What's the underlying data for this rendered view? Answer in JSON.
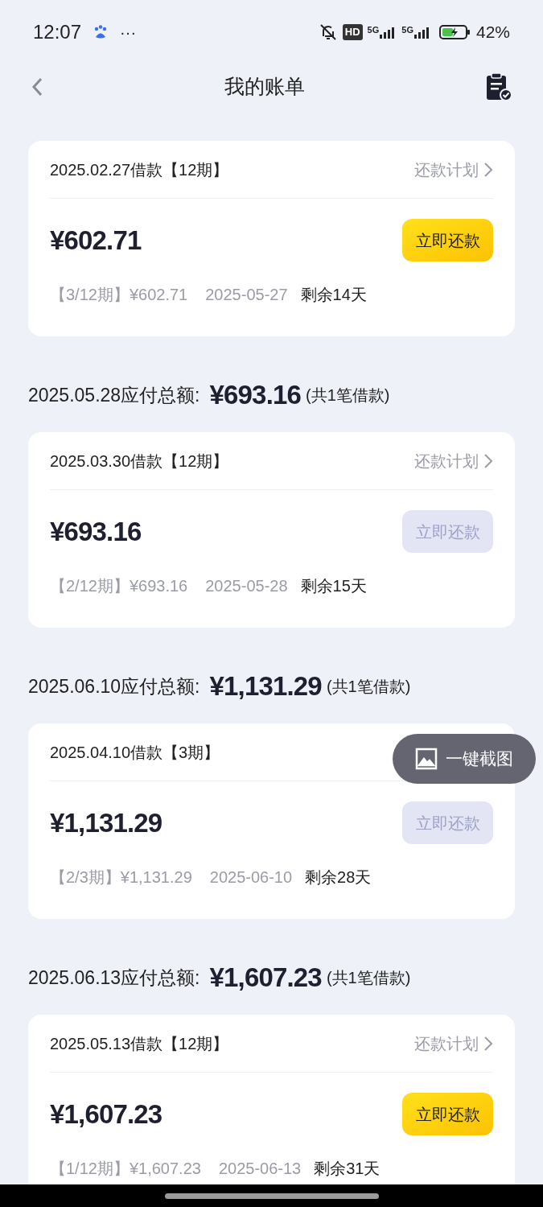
{
  "status_bar": {
    "time": "12:07",
    "more": "···",
    "hd": "HD",
    "networks": [
      "5G",
      "5G"
    ],
    "battery": "42%"
  },
  "header": {
    "title": "我的账单"
  },
  "groups": [
    {
      "loans": [
        {
          "title": "2025.02.27借款【12期】",
          "plan_link": "还款计划",
          "amount": "¥602.71",
          "pay_button": {
            "label": "立即还款",
            "disabled": false
          },
          "installment": "【3/12期】¥602.71",
          "due_date": "2025-05-27",
          "remaining": "剩余14天"
        }
      ]
    },
    {
      "summary": {
        "label": "2025.05.28应付总额:",
        "total": "¥693.16",
        "count": "(共1笔借款)"
      },
      "loans": [
        {
          "title": "2025.03.30借款【12期】",
          "plan_link": "还款计划",
          "amount": "¥693.16",
          "pay_button": {
            "label": "立即还款",
            "disabled": true
          },
          "installment": "【2/12期】¥693.16",
          "due_date": "2025-05-28",
          "remaining": "剩余15天"
        }
      ]
    },
    {
      "summary": {
        "label": "2025.06.10应付总额:",
        "total": "¥1,131.29",
        "count": "(共1笔借款)"
      },
      "loans": [
        {
          "title": "2025.04.10借款【3期】",
          "amount": "¥1,131.29",
          "pay_button": {
            "label": "立即还款",
            "disabled": true
          },
          "installment": "【2/3期】¥1,131.29",
          "due_date": "2025-06-10",
          "remaining": "剩余28天"
        }
      ]
    },
    {
      "summary": {
        "label": "2025.06.13应付总额:",
        "total": "¥1,607.23",
        "count": "(共1笔借款)"
      },
      "loans": [
        {
          "title": "2025.05.13借款【12期】",
          "plan_link": "还款计划",
          "amount": "¥1,607.23",
          "pay_button": {
            "label": "立即还款",
            "disabled": false
          },
          "installment": "【1/12期】¥1,607.23",
          "due_date": "2025-06-13",
          "remaining": "剩余31天"
        }
      ]
    }
  ],
  "floating_button": {
    "label": "一键截图"
  }
}
